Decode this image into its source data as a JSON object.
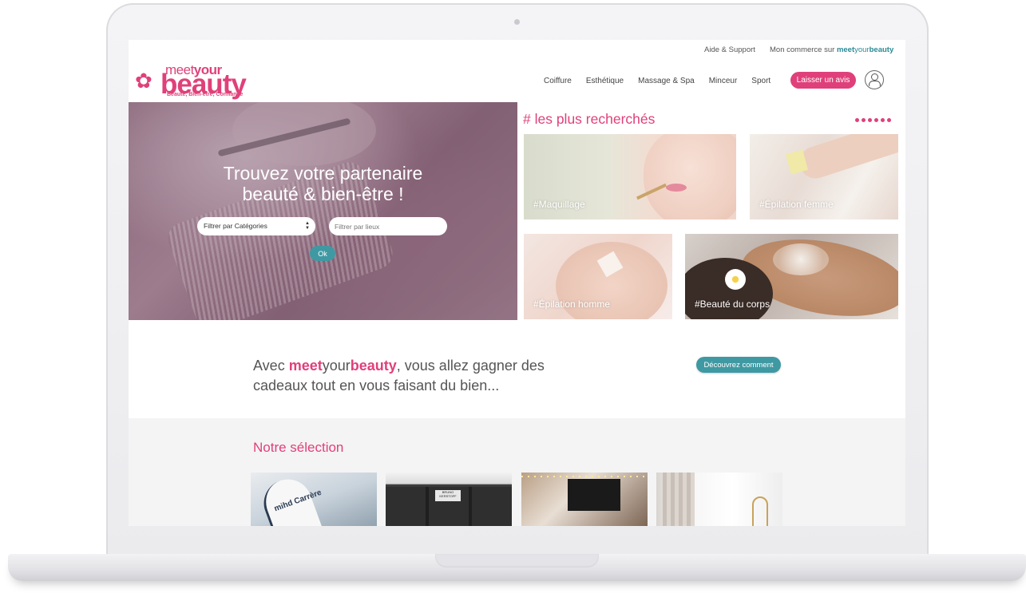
{
  "topbar": {
    "help": "Aide & Support",
    "merchant_prefix": "Mon commerce sur",
    "merchant_brand": {
      "meet": "meet",
      "your": "your",
      "beauty": "beauty"
    }
  },
  "logo": {
    "meet": "meet",
    "your": "your",
    "beauty": "beauty",
    "tagline": "Beauté, Bien-être, Confiance"
  },
  "nav": {
    "items": [
      "Coiffure",
      "Esthétique",
      "Massage & Spa",
      "Minceur",
      "Sport"
    ],
    "review_button": "Laisser un avis"
  },
  "hero": {
    "title_line1": "Trouvez votre partenaire",
    "title_line2": "beauté & bien-être !",
    "category_select": "Filtrer par Catégories",
    "location_placeholder": "Filtrer par lieux",
    "ok_button": "Ok"
  },
  "most_searched": {
    "title": "# les plus recherchés",
    "cards": [
      "#Maquillage",
      "#Épilation femme",
      "#Épilation homme",
      "#Beauté du corps"
    ],
    "dot_count": 6
  },
  "promo": {
    "prefix": "Avec ",
    "brand_meet": "meet",
    "brand_your": "your",
    "brand_beauty": "beauty",
    "suffix": ", vous allez gagner des cadeaux tout en vous faisant du bien...",
    "button": "Découvrez comment"
  },
  "selection": {
    "title": "Notre sélection",
    "thumb1_text": "mihd Carrère",
    "thumb2_text": "BRUNO KERSTOFF"
  },
  "colors": {
    "brand_pink": "#e0407a",
    "brand_teal": "#3f99a3"
  }
}
